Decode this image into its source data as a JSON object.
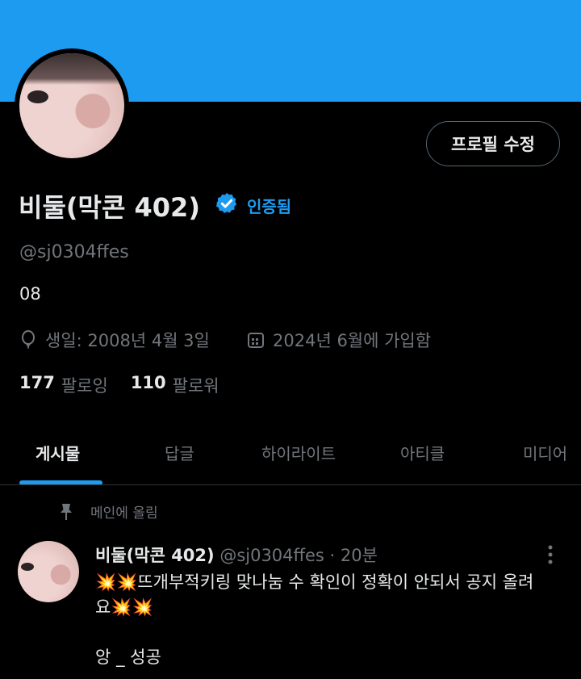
{
  "colors": {
    "accent": "#1d9bf0",
    "background": "#000000",
    "text": "#e7e9ea",
    "muted": "#71767b"
  },
  "profile": {
    "edit_button": "프로필 수정",
    "name": "비둘(막콘 402)",
    "verified_icon": "verified-badge-icon",
    "verified_label": "인증됨",
    "handle": "@sj0304ffes",
    "bio": "08",
    "birthday": "생일: 2008년 4월 3일",
    "joined": "2024년 6월에 가입함",
    "following_count": "177",
    "following_label": "팔로잉",
    "followers_count": "110",
    "followers_label": "팔로워"
  },
  "tabs": [
    {
      "label": "게시물",
      "active": true
    },
    {
      "label": "답글"
    },
    {
      "label": "하이라이트"
    },
    {
      "label": "아티클"
    },
    {
      "label": "미디어"
    }
  ],
  "post": {
    "pinned_label": "메인에 올림",
    "name": "비둘(막콘 402)",
    "meta": "@sj0304ffes · 20분",
    "text": "💥💥뜨개부적키링 맞나눔 수 확인이 정확이 안되서 공지 올려요💥💥\n\n앙 _ 성공"
  }
}
